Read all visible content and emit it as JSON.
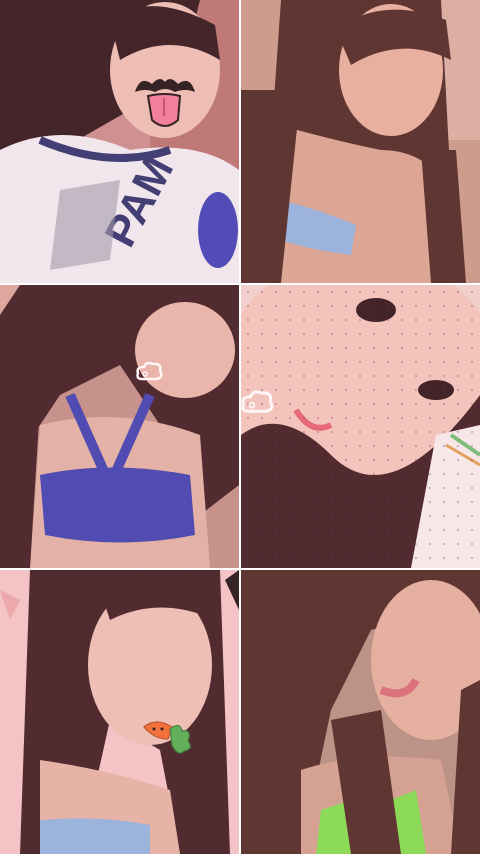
{
  "collage": {
    "panels": [
      {
        "id": "panel-1",
        "sticker": "mustache-tongue-sticker"
      },
      {
        "id": "panel-2",
        "sticker": ""
      },
      {
        "id": "panel-3",
        "sticker": "puff-cloud-sticker"
      },
      {
        "id": "panel-4",
        "sticker": "puff-cloud-sticker"
      },
      {
        "id": "panel-5",
        "sticker": "carrot-sticker"
      },
      {
        "id": "panel-6",
        "sticker": ""
      }
    ],
    "colors": {
      "hair": "#3a1a1c",
      "skin": "#e8b3a6",
      "blue_top": "#3a3fb0",
      "light_blue_top": "#8fb4e0",
      "green_top": "#7ee04a",
      "pink_background": "#f3c6c6"
    }
  }
}
